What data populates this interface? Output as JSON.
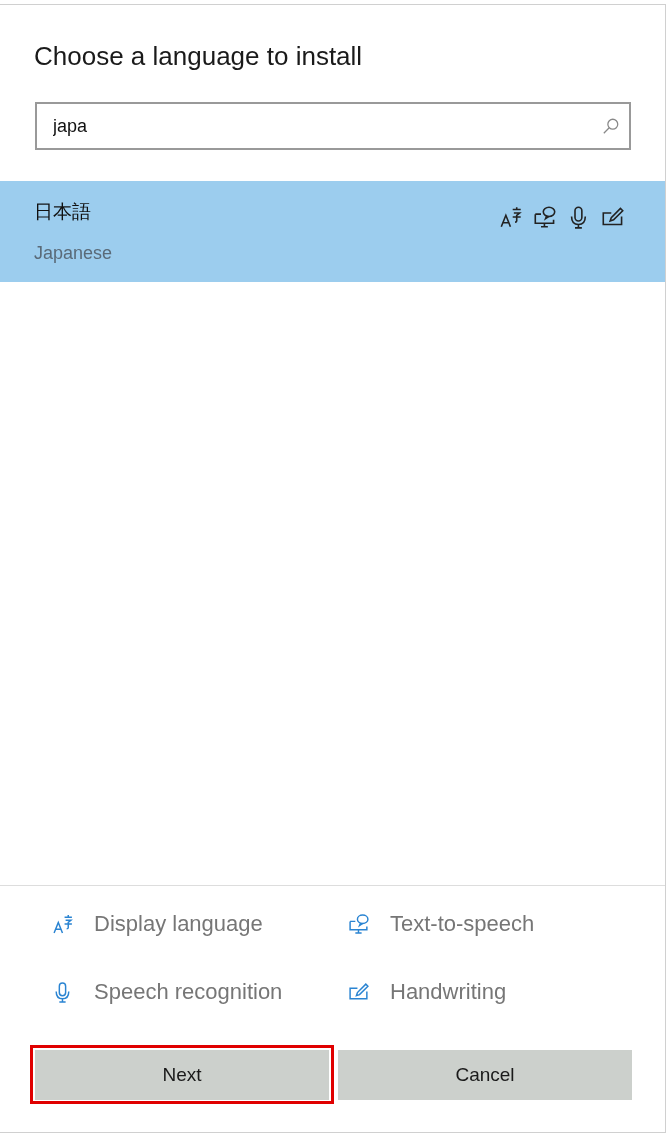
{
  "title": "Choose a language to install",
  "search": {
    "value": "japa"
  },
  "languages": [
    {
      "native_name": "日本語",
      "name": "Japanese",
      "selected": true,
      "features": [
        {
          "kind": "display"
        },
        {
          "kind": "tts"
        },
        {
          "kind": "speech"
        },
        {
          "kind": "handwriting"
        }
      ]
    }
  ],
  "legend": [
    {
      "kind": "display",
      "label": "Display language"
    },
    {
      "kind": "tts",
      "label": "Text-to-speech"
    },
    {
      "kind": "speech",
      "label": "Speech recognition"
    },
    {
      "kind": "handwriting",
      "label": "Handwriting"
    }
  ],
  "buttons": [
    {
      "label": "Next",
      "highlighted": true
    },
    {
      "label": "Cancel",
      "highlighted": false
    }
  ]
}
